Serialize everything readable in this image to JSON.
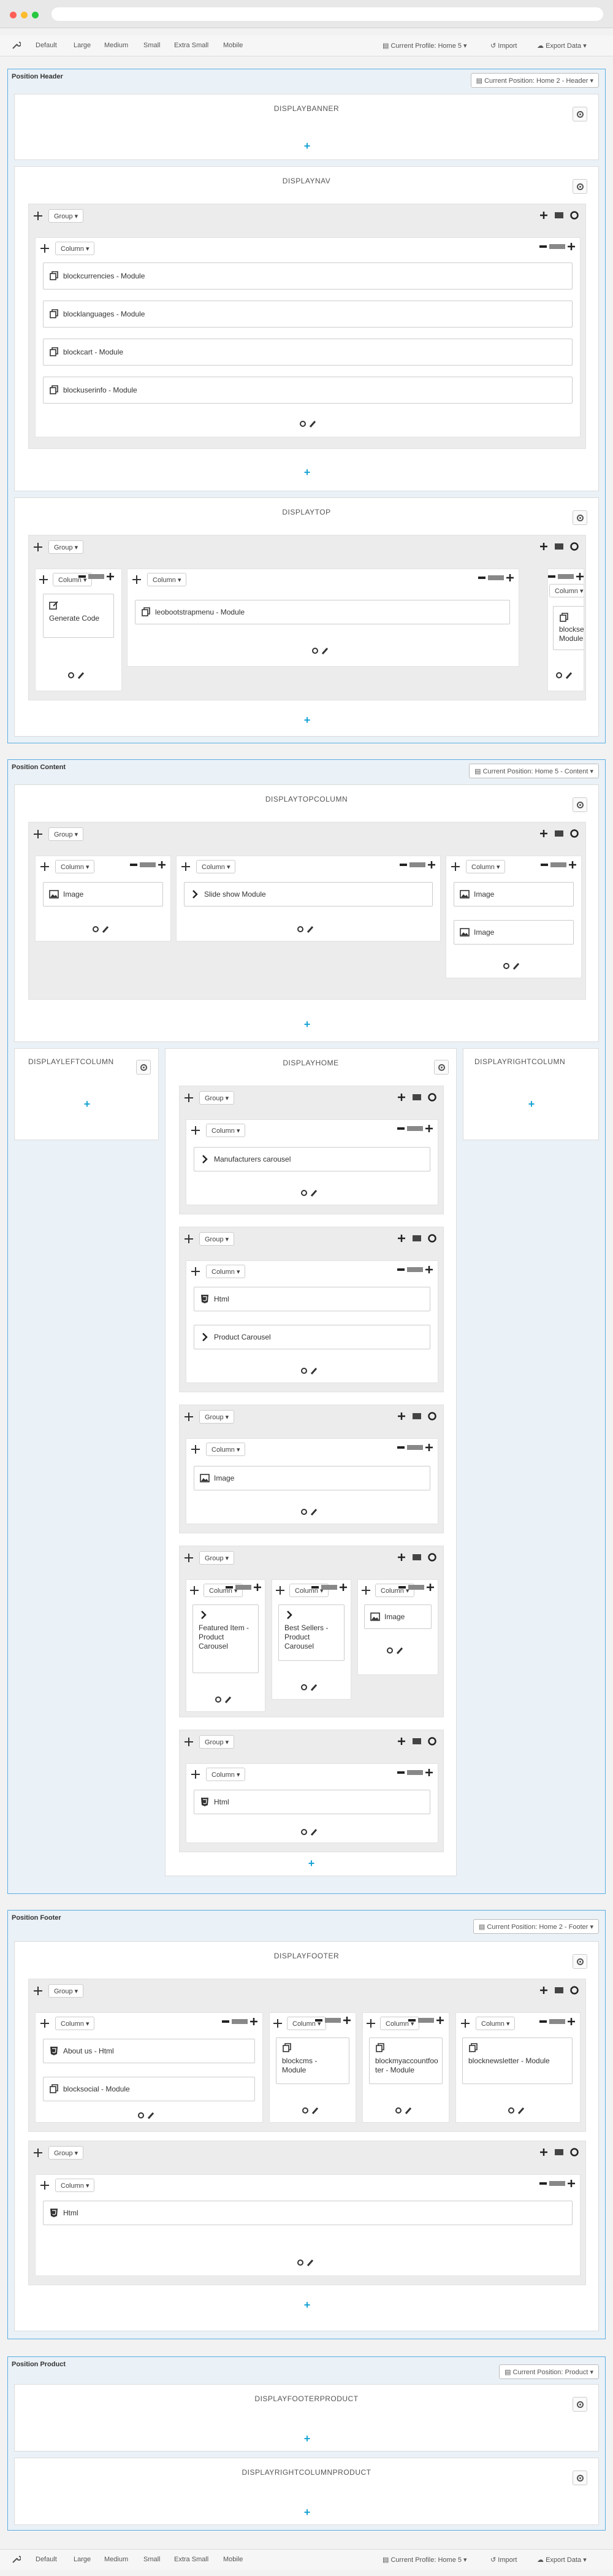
{
  "toolbar": {
    "devices": [
      "Default",
      "Large",
      "Medium",
      "Small",
      "Extra Small",
      "Mobile"
    ],
    "profile": "Current Profile: Home 5",
    "import": "Import",
    "export": "Export Data"
  },
  "controls": {
    "group": "Group",
    "column": "Column"
  },
  "header": {
    "title": "Position Header",
    "position_btn": "Current Position: Home 2 - Header",
    "banner": "DISPLAYBANNER",
    "nav": "DISPLAYNAV",
    "nav_modules": [
      "blockcurrencies - Module",
      "blocklanguages - Module",
      "blockcart - Module",
      "blockuserinfo - Module"
    ],
    "top": "DISPLAYTOP",
    "top_modules": [
      "Generate Code",
      "leobootstrapmenu - Module",
      "blocksearch - Module"
    ]
  },
  "content": {
    "title": "Position Content",
    "position_btn": "Current Position: Home 5 - Content",
    "topcolumn": "DISPLAYTOPCOLUMN",
    "top_modules": [
      "Image",
      "Slide show Module",
      "Image",
      "Image"
    ],
    "leftcolumn": "DISPLAYLEFTCOLUMN",
    "home": "DISPLAYHOME",
    "rightcolumn": "DISPLAYRIGHTCOLUMN",
    "home_modules": [
      "Manufacturers carousel",
      "Html",
      "Product Carousel",
      "Image",
      "Featured Item - Product Carousel",
      "Best Sellers - Product Carousel",
      "Image",
      "Html"
    ]
  },
  "footer": {
    "title": "Position Footer",
    "position_btn": "Current Position: Home 2 - Footer",
    "name": "DISPLAYFOOTER",
    "modules": [
      "About us - Html",
      "blocksocial - Module",
      "blockcms - Module",
      "blockmyaccountfooter - Module",
      "blocknewsletter - Module",
      "Html"
    ]
  },
  "product": {
    "title": "Position Product",
    "position_btn": "Current Position: Product",
    "footerproduct": "DISPLAYFOOTERPRODUCT",
    "rightcolumnproduct": "DISPLAYRIGHTCOLUMNPRODUCT"
  },
  "colors": {
    "accent": "#19a3d4",
    "border": "#5aaee3",
    "close": "#ff5f57",
    "minimize": "#febc2e",
    "zoom": "#28c840"
  }
}
